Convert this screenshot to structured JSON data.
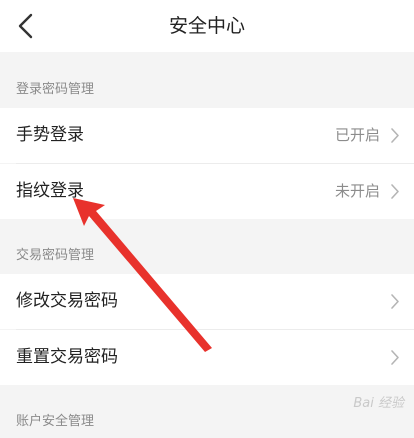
{
  "header": {
    "title": "安全中心",
    "back_icon": "chevron-left-icon"
  },
  "sections": [
    {
      "title": "登录密码管理",
      "rows": [
        {
          "label": "手势登录",
          "value": "已开启"
        },
        {
          "label": "指纹登录",
          "value": "未开启"
        }
      ]
    },
    {
      "title": "交易密码管理",
      "rows": [
        {
          "label": "修改交易密码",
          "value": ""
        },
        {
          "label": "重置交易密码",
          "value": ""
        }
      ]
    },
    {
      "title": "账户安全管理",
      "rows": []
    }
  ],
  "annotation": {
    "color": "#e8322c",
    "icon": "red-pointer-arrow"
  },
  "watermark": {
    "text": "Bai 经验"
  }
}
